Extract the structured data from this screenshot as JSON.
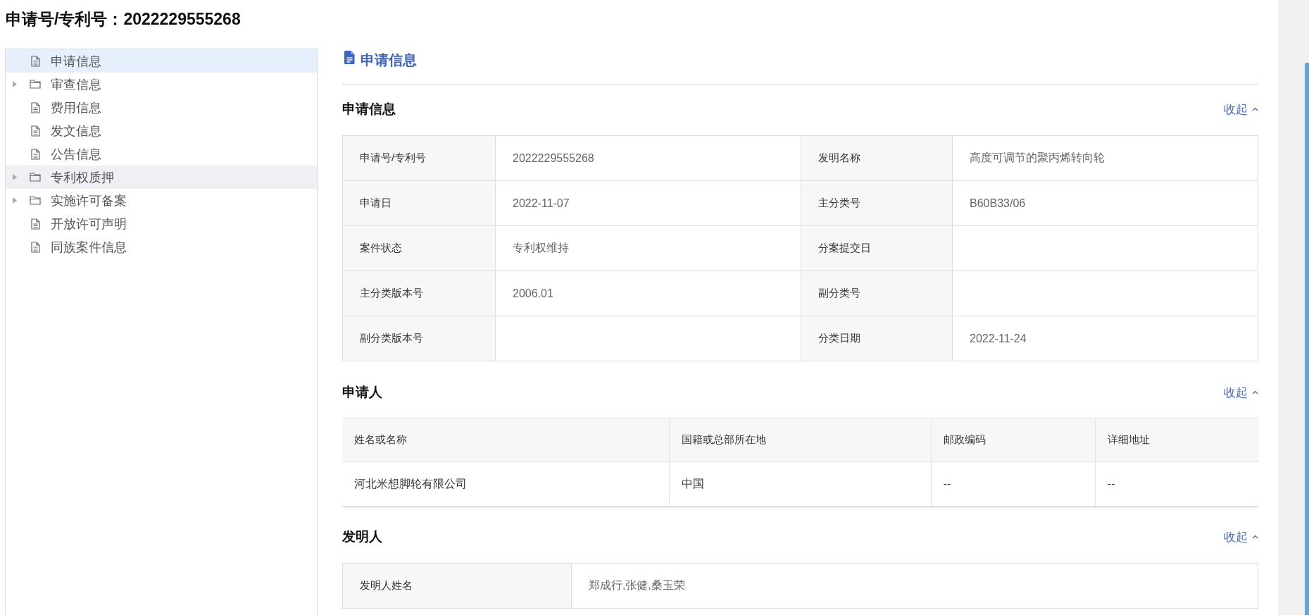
{
  "page_title": "申请号/专利号：2022229555268",
  "nav": {
    "items": [
      {
        "label": "申请信息",
        "kind": "file",
        "selected": true,
        "hovered": false
      },
      {
        "label": "审查信息",
        "kind": "folder",
        "selected": false,
        "hovered": false
      },
      {
        "label": "费用信息",
        "kind": "file",
        "selected": false,
        "hovered": false
      },
      {
        "label": "发文信息",
        "kind": "file",
        "selected": false,
        "hovered": false
      },
      {
        "label": "公告信息",
        "kind": "file",
        "selected": false,
        "hovered": false
      },
      {
        "label": "专利权质押",
        "kind": "folder",
        "selected": false,
        "hovered": true
      },
      {
        "label": "实施许可备案",
        "kind": "folder",
        "selected": false,
        "hovered": false
      },
      {
        "label": "开放许可声明",
        "kind": "file",
        "selected": false,
        "hovered": false
      },
      {
        "label": "同族案件信息",
        "kind": "file",
        "selected": false,
        "hovered": false
      }
    ]
  },
  "content": {
    "heading": "申请信息",
    "sections": [
      {
        "kind": "kv",
        "title": "申请信息",
        "toggle": "收起",
        "rows": [
          [
            {
              "label": "申请号/专利号",
              "value": "2022229555268"
            },
            {
              "label": "发明名称",
              "value": "高度可调节的聚丙烯转向轮"
            }
          ],
          [
            {
              "label": "申请日",
              "value": "2022-11-07"
            },
            {
              "label": "主分类号",
              "value": "B60B33/06"
            }
          ],
          [
            {
              "label": "案件状态",
              "value": "专利权维持"
            },
            {
              "label": "分案提交日"
            }
          ],
          [
            {
              "label": "主分类版本号",
              "value": "2006.01"
            },
            {
              "label": "副分类号"
            }
          ],
          [
            {
              "label": "副分类版本号"
            },
            {
              "label": "分类日期",
              "value": "2022-11-24"
            }
          ]
        ]
      },
      {
        "kind": "grid",
        "title": "申请人",
        "toggle": "收起",
        "columns": [
          "姓名或名称",
          "国籍或总部所在地",
          "邮政编码",
          "详细地址"
        ],
        "rows": [
          [
            "河北米想脚轮有限公司",
            "中国",
            "--",
            "--"
          ]
        ]
      },
      {
        "kind": "kv",
        "title": "发明人",
        "toggle": "收起",
        "rows": [
          [
            {
              "label": "发明人姓名",
              "value": "郑成行,张健,桑玉荣"
            }
          ]
        ]
      }
    ]
  }
}
